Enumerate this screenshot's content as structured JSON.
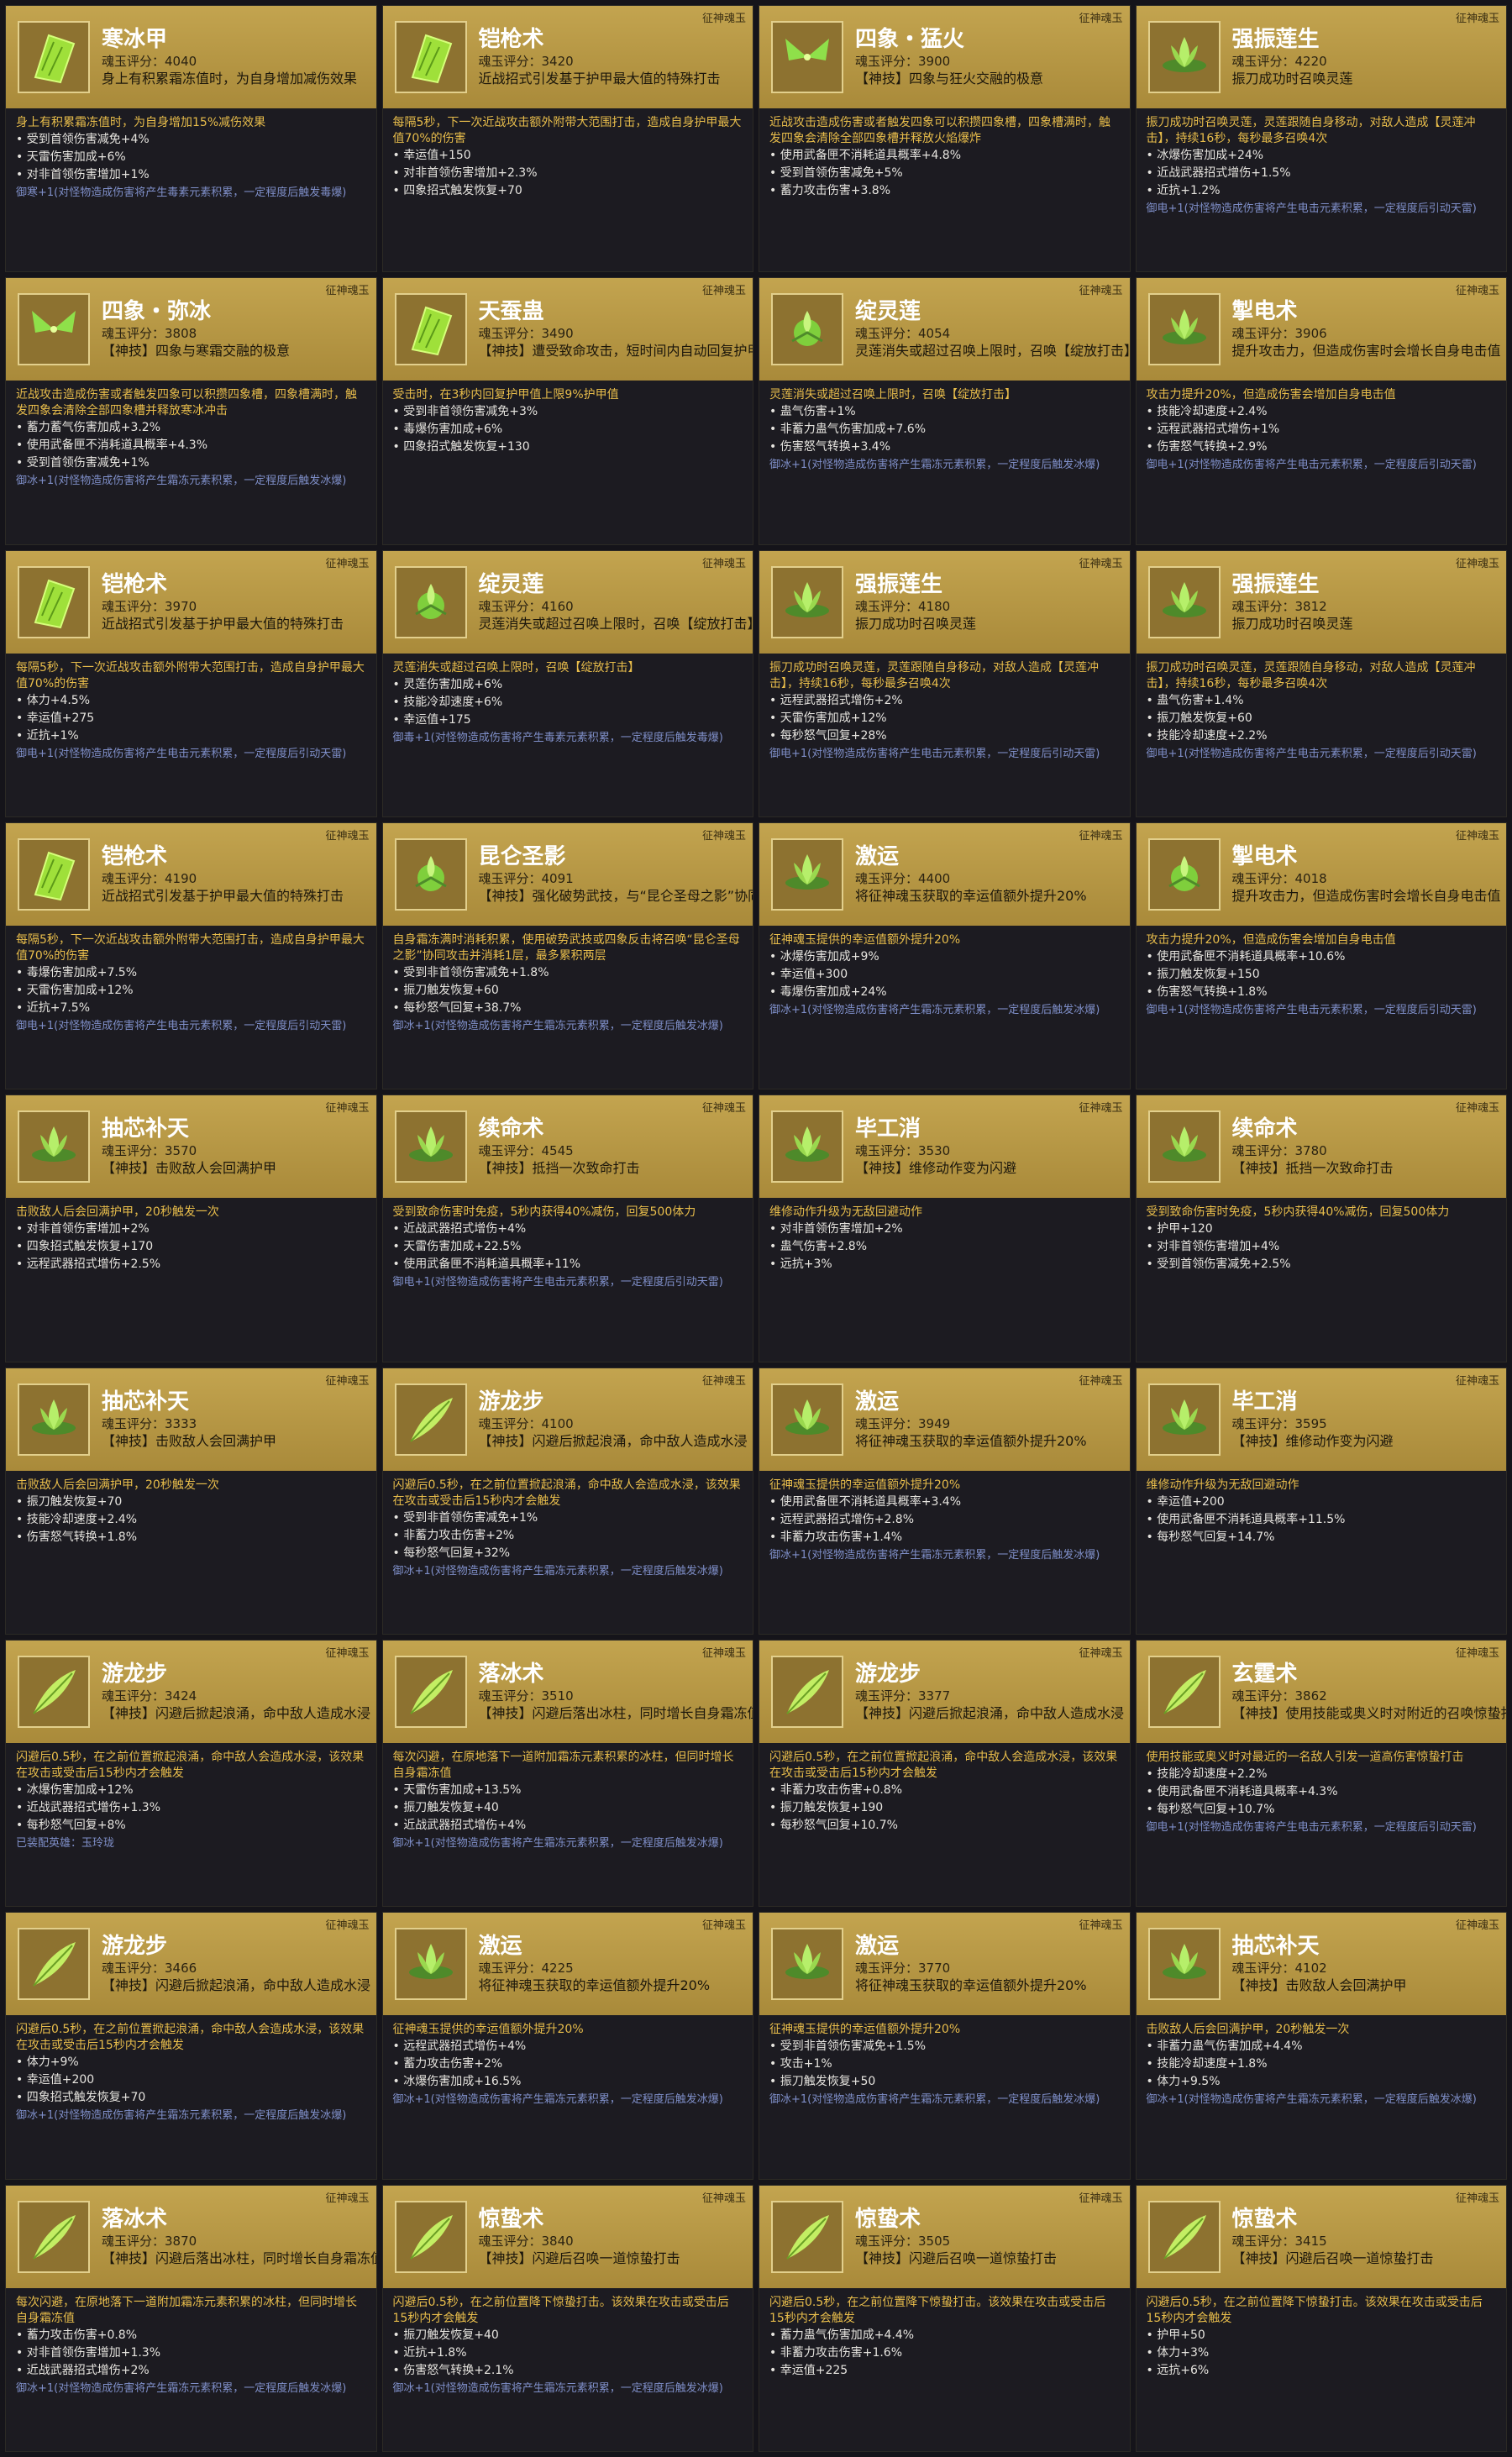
{
  "cards": [
    {
      "name": "寒冰甲",
      "score": "魂玉评分：4040",
      "desc": "身上有积累霜冻值时，为自身增加减伤效果",
      "tag": "",
      "icon": "green-leaf-icon",
      "note": "身上有积累霜冻值时，为自身增加15%减伤效果",
      "stats": [
        "受到首领伤害减免+4%",
        "天雷伤害加成+6%",
        "对非首领伤害增加+1%"
      ],
      "set": "御寒+1(对怪物造成伤害将产生毒素元素积累，一定程度后触发毒爆)"
    },
    {
      "name": "铠枪术",
      "score": "魂玉评分：3420",
      "desc": "近战招式引发基于护甲最大值的特殊打击",
      "tag": "征神魂玉",
      "icon": "green-leaf-icon",
      "note": "每隔5秒，下一次近战攻击额外附带大范围打击，造成自身护甲最大值70%的伤害",
      "stats": [
        "幸运值+150",
        "对非首领伤害增加+2.3%",
        "四象招式触发恢复+70"
      ],
      "set": ""
    },
    {
      "name": "四象・猛火",
      "score": "魂玉评分：3900",
      "desc": "【神技】四象与狂火交融的极意",
      "tag": "征神魂玉",
      "icon": "green-butterfly-icon",
      "note": "近战攻击造成伤害或者触发四象可以积攒四象槽，四象槽满时，触发四象会清除全部四象槽并释放火焰爆炸",
      "stats": [
        "使用武备匣不消耗道具概率+4.8%",
        "受到首领伤害减免+5%",
        "蓄力攻击伤害+3.8%"
      ],
      "set": ""
    },
    {
      "name": "强振莲生",
      "score": "魂玉评分：4220",
      "desc": "振刀成功时召唤灵莲",
      "tag": "征神魂玉",
      "icon": "lotus-icon",
      "note": "振刀成功时召唤灵莲，灵莲跟随自身移动，对敌人造成【灵莲冲击】，持续16秒，每秒最多召唤4次",
      "stats": [
        "冰爆伤害加成+24%",
        "近战武器招式增伤+1.5%",
        "近抗+1.2%"
      ],
      "set": "御电+1(对怪物造成伤害将产生电击元素积累，一定程度后引动天雷)"
    },
    {
      "name": "四象・弥冰",
      "score": "魂玉评分：3808",
      "desc": "【神技】四象与寒霜交融的极意",
      "tag": "征神魂玉",
      "icon": "green-butterfly-icon",
      "note": "近战攻击造成伤害或者触发四象可以积攒四象槽，四象槽满时，触发四象会清除全部四象槽并释放寒冰冲击",
      "stats": [
        "蓄力蓄气伤害加成+3.2%",
        "使用武备匣不消耗道具概率+4.3%",
        "受到首领伤害减免+1%"
      ],
      "set": "御冰+1(对怪物造成伤害将产生霜冻元素积累，一定程度后触发冰爆)"
    },
    {
      "name": "天蚕蛊",
      "score": "魂玉评分：3490",
      "desc": "【神技】遭受致命攻击，短时间内自动回复护甲",
      "tag": "征神魂玉",
      "icon": "green-leaf-icon",
      "note": "受击时，在3秒内回复护甲值上限9%护甲值",
      "stats": [
        "受到非首领伤害减免+3%",
        "毒爆伤害加成+6%",
        "四象招式触发恢复+130"
      ],
      "set": ""
    },
    {
      "name": "绽灵莲",
      "score": "魂玉评分：4054",
      "desc": "灵莲消失或超过召唤上限时，召唤【绽放打击】",
      "tag": "征神魂玉",
      "icon": "lotus-bud-icon",
      "note": "灵莲消失或超过召唤上限时，召唤【绽放打击】",
      "stats": [
        "蛊气伤害+1%",
        "非蓄力蛊气伤害加成+7.6%",
        "伤害怒气转换+3.4%"
      ],
      "set": "御冰+1(对怪物造成伤害将产生霜冻元素积累，一定程度后触发冰爆)"
    },
    {
      "name": "掣电术",
      "score": "魂玉评分：3906",
      "desc": "提升攻击力，但造成伤害时会增长自身电击值",
      "tag": "征神魂玉",
      "icon": "lotus-icon",
      "note": "攻击力提升20%，但造成伤害会增加自身电击值",
      "stats": [
        "技能冷却速度+2.4%",
        "远程武器招式增伤+1%",
        "伤害怒气转换+2.9%"
      ],
      "set": "御电+1(对怪物造成伤害将产生电击元素积累，一定程度后引动天雷)"
    },
    {
      "name": "铠枪术",
      "score": "魂玉评分：3970",
      "desc": "近战招式引发基于护甲最大值的特殊打击",
      "tag": "征神魂玉",
      "icon": "green-leaf-icon",
      "note": "每隔5秒，下一次近战攻击额外附带大范围打击，造成自身护甲最大值70%的伤害",
      "stats": [
        "体力+4.5%",
        "幸运值+275",
        "近抗+1%"
      ],
      "set": "御电+1(对怪物造成伤害将产生电击元素积累，一定程度后引动天雷)"
    },
    {
      "name": "绽灵莲",
      "score": "魂玉评分：4160",
      "desc": "灵莲消失或超过召唤上限时，召唤【绽放打击】",
      "tag": "征神魂玉",
      "icon": "lotus-bud-icon",
      "note": "灵莲消失或超过召唤上限时，召唤【绽放打击】",
      "stats": [
        "灵莲伤害加成+6%",
        "技能冷却速度+6%",
        "幸运值+175"
      ],
      "set": "御毒+1(对怪物造成伤害将产生毒素元素积累，一定程度后触发毒爆)"
    },
    {
      "name": "强振莲生",
      "score": "魂玉评分：4180",
      "desc": "振刀成功时召唤灵莲",
      "tag": "征神魂玉",
      "icon": "lotus-icon",
      "note": "振刀成功时召唤灵莲，灵莲跟随自身移动，对敌人造成【灵莲冲击】，持续16秒，每秒最多召唤4次",
      "stats": [
        "远程武器招式增伤+2%",
        "天雷伤害加成+12%",
        "每秒怒气回复+28%"
      ],
      "set": "御电+1(对怪物造成伤害将产生电击元素积累，一定程度后引动天雷)"
    },
    {
      "name": "强振莲生",
      "score": "魂玉评分：3812",
      "desc": "振刀成功时召唤灵莲",
      "tag": "征神魂玉",
      "icon": "lotus-icon",
      "note": "振刀成功时召唤灵莲，灵莲跟随自身移动，对敌人造成【灵莲冲击】，持续16秒，每秒最多召唤4次",
      "stats": [
        "蛊气伤害+1.4%",
        "振刀触发恢复+60",
        "技能冷却速度+2.2%"
      ],
      "set": "御电+1(对怪物造成伤害将产生电击元素积累，一定程度后引动天雷)"
    },
    {
      "name": "铠枪术",
      "score": "魂玉评分：4190",
      "desc": "近战招式引发基于护甲最大值的特殊打击",
      "tag": "征神魂玉",
      "icon": "green-leaf-icon",
      "note": "每隔5秒，下一次近战攻击额外附带大范围打击，造成自身护甲最大值70%的伤害",
      "stats": [
        "毒爆伤害加成+7.5%",
        "天雷伤害加成+12%",
        "近抗+7.5%"
      ],
      "set": "御电+1(对怪物造成伤害将产生电击元素积累，一定程度后引动天雷)"
    },
    {
      "name": "昆仑圣影",
      "score": "魂玉评分：4091",
      "desc": "【神技】强化破势武技，与“昆仑圣母之影”协同攻击",
      "tag": "征神魂玉",
      "icon": "lotus-bud-icon",
      "note": "自身霜冻满时消耗积累，使用破势武技或四象反击将召唤“昆仑圣母之影”协同攻击并消耗1层，最多累积两层",
      "stats": [
        "受到非首领伤害减免+1.8%",
        "振刀触发恢复+60",
        "每秒怒气回复+38.7%"
      ],
      "set": "御冰+1(对怪物造成伤害将产生霜冻元素积累，一定程度后触发冰爆)"
    },
    {
      "name": "激运",
      "score": "魂玉评分：4400",
      "desc": "将征神魂玉获取的幸运值额外提升20%",
      "tag": "征神魂玉",
      "icon": "lotus-icon",
      "note": "征神魂玉提供的幸运值额外提升20%",
      "stats": [
        "冰爆伤害加成+9%",
        "幸运值+300",
        "毒爆伤害加成+24%"
      ],
      "set": "御冰+1(对怪物造成伤害将产生霜冻元素积累，一定程度后触发冰爆)"
    },
    {
      "name": "掣电术",
      "score": "魂玉评分：4018",
      "desc": "提升攻击力，但造成伤害时会增长自身电击值",
      "tag": "征神魂玉",
      "icon": "lotus-bud-icon",
      "note": "攻击力提升20%，但造成伤害会增加自身电击值",
      "stats": [
        "使用武备匣不消耗道具概率+10.6%",
        "振刀触发恢复+150",
        "伤害怒气转换+1.8%"
      ],
      "set": "御电+1(对怪物造成伤害将产生电击元素积累，一定程度后引动天雷)"
    },
    {
      "name": "抽芯补天",
      "score": "魂玉评分：3570",
      "desc": "【神技】击败敌人会回满护甲",
      "tag": "征神魂玉",
      "icon": "lotus-icon",
      "note": "击败敌人后会回满护甲，20秒触发一次",
      "stats": [
        "对非首领伤害增加+2%",
        "四象招式触发恢复+170",
        "远程武器招式增伤+2.5%"
      ],
      "set": ""
    },
    {
      "name": "续命术",
      "score": "魂玉评分：4545",
      "desc": "【神技】抵挡一次致命打击",
      "tag": "征神魂玉",
      "icon": "lotus-icon",
      "note": "受到致命伤害时免疫，5秒内获得40%减伤，回复500体力",
      "stats": [
        "近战武器招式增伤+4%",
        "天雷伤害加成+22.5%",
        "使用武备匣不消耗道具概率+11%"
      ],
      "set": "御电+1(对怪物造成伤害将产生电击元素积累，一定程度后引动天雷)"
    },
    {
      "name": "毕工消",
      "score": "魂玉评分：3530",
      "desc": "【神技】维修动作变为闪避",
      "tag": "征神魂玉",
      "icon": "lotus-icon",
      "note": "维修动作升级为无敌回避动作",
      "stats": [
        "对非首领伤害增加+2%",
        "蛊气伤害+2.8%",
        "远抗+3%"
      ],
      "set": ""
    },
    {
      "name": "续命术",
      "score": "魂玉评分：3780",
      "desc": "【神技】抵挡一次致命打击",
      "tag": "征神魂玉",
      "icon": "lotus-icon",
      "note": "受到致命伤害时免疫，5秒内获得40%减伤，回复500体力",
      "stats": [
        "护甲+120",
        "对非首领伤害增加+4%",
        "受到首领伤害减免+2.5%"
      ],
      "set": ""
    },
    {
      "name": "抽芯补天",
      "score": "魂玉评分：3333",
      "desc": "【神技】击败敌人会回满护甲",
      "tag": "征神魂玉",
      "icon": "lotus-icon",
      "note": "击败敌人后会回满护甲，20秒触发一次",
      "stats": [
        "振刀触发恢复+70",
        "技能冷却速度+2.4%",
        "伤害怒气转换+1.8%"
      ],
      "set": ""
    },
    {
      "name": "游龙步",
      "score": "魂玉评分：4100",
      "desc": "【神技】闪避后掀起浪涌，命中敌人造成水浸",
      "tag": "征神魂玉",
      "icon": "feather-icon",
      "note": "闪避后0.5秒，在之前位置掀起浪涌，命中敌人会造成水浸，该效果在攻击或受击后15秒内才会触发",
      "stats": [
        "受到非首领伤害减免+1%",
        "非蓄力攻击伤害+2%",
        "每秒怒气回复+32%"
      ],
      "set": "御冰+1(对怪物造成伤害将产生霜冻元素积累，一定程度后触发冰爆)"
    },
    {
      "name": "激运",
      "score": "魂玉评分：3949",
      "desc": "将征神魂玉获取的幸运值额外提升20%",
      "tag": "征神魂玉",
      "icon": "lotus-icon",
      "note": "征神魂玉提供的幸运值额外提升20%",
      "stats": [
        "使用武备匣不消耗道具概率+3.4%",
        "远程武器招式增伤+2.8%",
        "非蓄力攻击伤害+1.4%"
      ],
      "set": "御冰+1(对怪物造成伤害将产生霜冻元素积累，一定程度后触发冰爆)"
    },
    {
      "name": "毕工消",
      "score": "魂玉评分：3595",
      "desc": "【神技】维修动作变为闪避",
      "tag": "征神魂玉",
      "icon": "lotus-icon",
      "note": "维修动作升级为无敌回避动作",
      "stats": [
        "幸运值+200",
        "使用武备匣不消耗道具概率+11.5%",
        "每秒怒气回复+14.7%"
      ],
      "set": ""
    },
    {
      "name": "游龙步",
      "score": "魂玉评分：3424",
      "desc": "【神技】闪避后掀起浪涌，命中敌人造成水浸",
      "tag": "征神魂玉",
      "icon": "feather-icon",
      "note": "闪避后0.5秒，在之前位置掀起浪涌，命中敌人会造成水浸，该效果在攻击或受击后15秒内才会触发",
      "stats": [
        "冰爆伤害加成+12%",
        "近战武器招式增伤+1.3%",
        "每秒怒气回复+8%"
      ],
      "set": "已装配英雄：玉玲珑"
    },
    {
      "name": "落冰术",
      "score": "魂玉评分：3510",
      "desc": "【神技】闪避后落出冰柱，同时增长自身霜冻值",
      "tag": "征神魂玉",
      "icon": "feather-icon",
      "note": "每次闪避，在原地落下一道附加霜冻元素积累的冰柱，但同时增长自身霜冻值",
      "stats": [
        "天雷伤害加成+13.5%",
        "振刀触发恢复+40",
        "近战武器招式增伤+4%"
      ],
      "set": "御冰+1(对怪物造成伤害将产生霜冻元素积累，一定程度后触发冰爆)"
    },
    {
      "name": "游龙步",
      "score": "魂玉评分：3377",
      "desc": "【神技】闪避后掀起浪涌，命中敌人造成水浸",
      "tag": "征神魂玉",
      "icon": "feather-icon",
      "note": "闪避后0.5秒，在之前位置掀起浪涌，命中敌人会造成水浸，该效果在攻击或受击后15秒内才会触发",
      "stats": [
        "非蓄力攻击伤害+0.8%",
        "振刀触发恢复+190",
        "每秒怒气回复+10.7%"
      ],
      "set": ""
    },
    {
      "name": "玄霆术",
      "score": "魂玉评分：3862",
      "desc": "【神技】使用技能或奥义时对附近的召唤惊蛰打击",
      "tag": "征神魂玉",
      "icon": "feather-icon",
      "note": "使用技能或奥义时对最近的一名敌人引发一道高伤害惊蛰打击",
      "stats": [
        "技能冷却速度+2.2%",
        "使用武备匣不消耗道具概率+4.3%",
        "每秒怒气回复+10.7%"
      ],
      "set": "御电+1(对怪物造成伤害将产生电击元素积累，一定程度后引动天雷)"
    },
    {
      "name": "游龙步",
      "score": "魂玉评分：3466",
      "desc": "【神技】闪避后掀起浪涌，命中敌人造成水浸",
      "tag": "征神魂玉",
      "icon": "feather-icon",
      "note": "闪避后0.5秒，在之前位置掀起浪涌，命中敌人会造成水浸，该效果在攻击或受击后15秒内才会触发",
      "stats": [
        "体力+9%",
        "幸运值+200",
        "四象招式触发恢复+70"
      ],
      "set": "御冰+1(对怪物造成伤害将产生霜冻元素积累，一定程度后触发冰爆)"
    },
    {
      "name": "激运",
      "score": "魂玉评分：4225",
      "desc": "将征神魂玉获取的幸运值额外提升20%",
      "tag": "征神魂玉",
      "icon": "lotus-icon",
      "note": "征神魂玉提供的幸运值额外提升20%",
      "stats": [
        "远程武器招式增伤+4%",
        "蓄力攻击伤害+2%",
        "冰爆伤害加成+16.5%"
      ],
      "set": "御冰+1(对怪物造成伤害将产生霜冻元素积累，一定程度后触发冰爆)"
    },
    {
      "name": "激运",
      "score": "魂玉评分：3770",
      "desc": "将征神魂玉获取的幸运值额外提升20%",
      "tag": "征神魂玉",
      "icon": "lotus-icon",
      "note": "征神魂玉提供的幸运值额外提升20%",
      "stats": [
        "受到非首领伤害减免+1.5%",
        "攻击+1%",
        "振刀触发恢复+50"
      ],
      "set": "御冰+1(对怪物造成伤害将产生霜冻元素积累，一定程度后触发冰爆)"
    },
    {
      "name": "抽芯补天",
      "score": "魂玉评分：4102",
      "desc": "【神技】击败敌人会回满护甲",
      "tag": "征神魂玉",
      "icon": "lotus-icon",
      "note": "击败敌人后会回满护甲，20秒触发一次",
      "stats": [
        "非蓄力蛊气伤害加成+4.4%",
        "技能冷却速度+1.8%",
        "体力+9.5%"
      ],
      "set": "御冰+1(对怪物造成伤害将产生霜冻元素积累，一定程度后触发冰爆)"
    },
    {
      "name": "落冰术",
      "score": "魂玉评分：3870",
      "desc": "【神技】闪避后落出冰柱，同时增长自身霜冻值",
      "tag": "征神魂玉",
      "icon": "feather-icon",
      "note": "每次闪避，在原地落下一道附加霜冻元素积累的冰柱，但同时增长自身霜冻值",
      "stats": [
        "蓄力攻击伤害+0.8%",
        "对非首领伤害增加+1.3%",
        "近战武器招式增伤+2%"
      ],
      "set": "御冰+1(对怪物造成伤害将产生霜冻元素积累，一定程度后触发冰爆)"
    },
    {
      "name": "惊蛰术",
      "score": "魂玉评分：3840",
      "desc": "【神技】闪避后召唤一道惊蛰打击",
      "tag": "征神魂玉",
      "icon": "feather-icon",
      "note": "闪避后0.5秒，在之前位置降下惊蛰打击。该效果在攻击或受击后15秒内才会触发",
      "stats": [
        "振刀触发恢复+40",
        "近抗+1.8%",
        "伤害怒气转换+2.1%"
      ],
      "set": "御冰+1(对怪物造成伤害将产生霜冻元素积累，一定程度后触发冰爆)"
    },
    {
      "name": "惊蛰术",
      "score": "魂玉评分：3505",
      "desc": "【神技】闪避后召唤一道惊蛰打击",
      "tag": "征神魂玉",
      "icon": "feather-icon",
      "note": "闪避后0.5秒，在之前位置降下惊蛰打击。该效果在攻击或受击后15秒内才会触发",
      "stats": [
        "蓄力蛊气伤害加成+4.4%",
        "非蓄力攻击伤害+1.6%",
        "幸运值+225"
      ],
      "set": ""
    },
    {
      "name": "惊蛰术",
      "score": "魂玉评分：3415",
      "desc": "【神技】闪避后召唤一道惊蛰打击",
      "tag": "征神魂玉",
      "icon": "feather-icon",
      "note": "闪避后0.5秒，在之前位置降下惊蛰打击。该效果在攻击或受击后15秒内才会触发",
      "stats": [
        "护甲+50",
        "体力+3%",
        "远抗+6%"
      ],
      "set": ""
    }
  ]
}
